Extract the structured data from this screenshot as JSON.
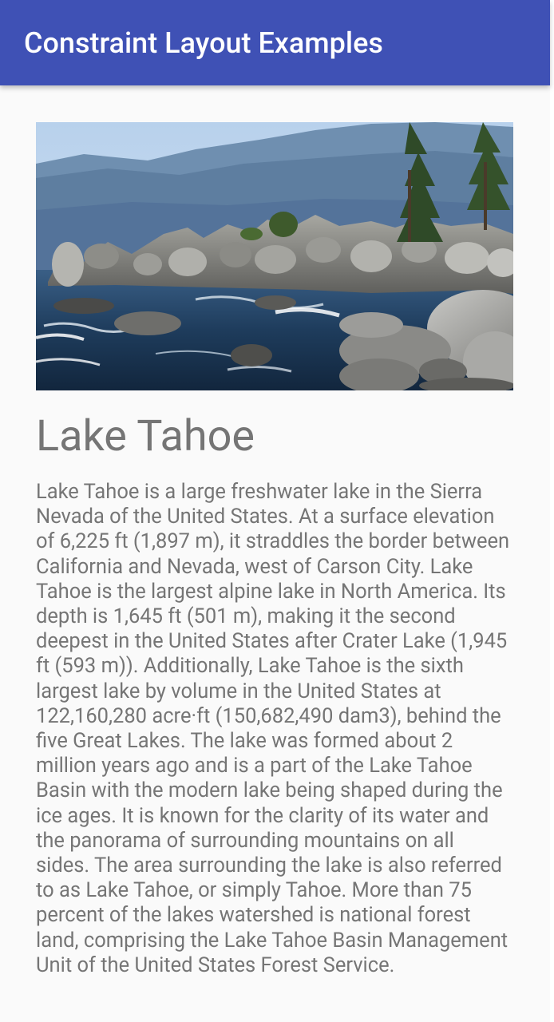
{
  "app_bar": {
    "title": "Constraint Layout Examples",
    "color": "#3f51b5"
  },
  "hero_image": {
    "subject": "Lake Tahoe shoreline with boulders, pine trees and mountains"
  },
  "article": {
    "title": "Lake Tahoe",
    "description": "Lake Tahoe is a large freshwater lake in the Sierra Nevada of the United States. At a surface elevation of 6,225 ft (1,897 m), it straddles the border between California and Nevada, west of Carson City. Lake Tahoe is the largest alpine lake in North America. Its depth is 1,645 ft (501 m), making it the second deepest in the United States after Crater Lake (1,945 ft (593 m)). Additionally, Lake Tahoe is the sixth largest lake by volume in the United States at 122,160,280 acre·ft (150,682,490 dam3), behind the five Great Lakes. The lake was formed about 2 million years ago and is a part of the Lake Tahoe Basin with the modern lake being shaped during the ice ages. It is known for the clarity of its water and the panorama of surrounding mountains on all sides. The area surrounding the lake is also referred to as Lake Tahoe, or simply Tahoe. More than 75 percent of the lakes watershed is national forest land, comprising the Lake Tahoe Basin Management Unit of the United States Forest Service."
  }
}
